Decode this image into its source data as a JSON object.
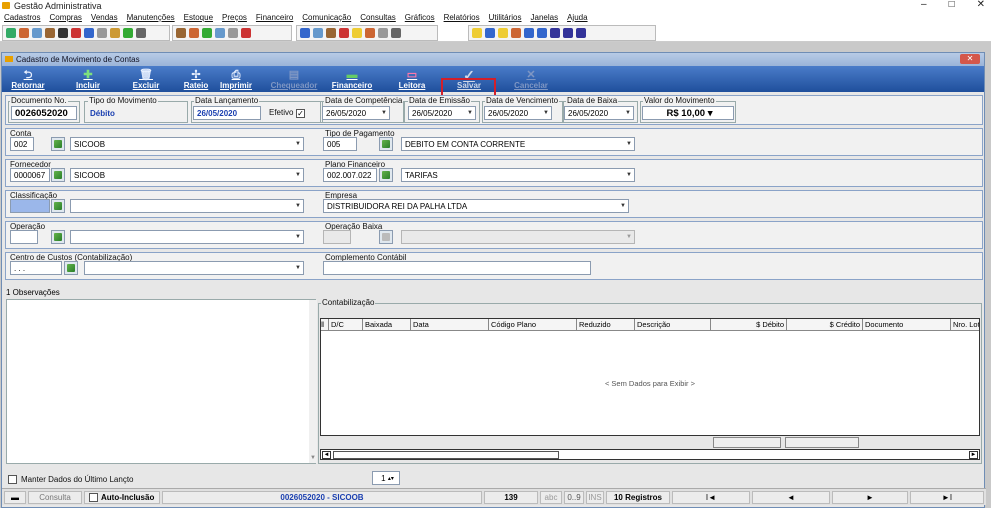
{
  "app_title": "Gestão Administrativa",
  "window_controls": {
    "min": "–",
    "max": "□",
    "close": "✕"
  },
  "menu": [
    "Cadastros",
    "Compras",
    "Vendas",
    "Manutenções",
    "Estoque",
    "Preços",
    "Financeiro",
    "Comunicação",
    "Consultas",
    "Gráficos",
    "Relatórios",
    "Utilitários",
    "Janelas",
    "Ajuda"
  ],
  "window_title": "Cadastro de Movimento de Contas",
  "toolbar": {
    "retornar": "Retornar",
    "incluir": "Incluir",
    "excluir": "Excluir",
    "rateio": "Rateio",
    "imprimir": "Imprimir",
    "chequeador": "Chequeador",
    "financeiro": "Financeiro",
    "leitora": "Leitora",
    "salvar": "Salvar",
    "cancelar": "Cancelar"
  },
  "form": {
    "documento": {
      "label": "Documento No.",
      "value": "0026052020"
    },
    "tipo": {
      "label": "Tipo do Movimento",
      "value": "Débito"
    },
    "lancamento": {
      "label": "Data Lançamento",
      "value": "26/05/2020"
    },
    "efetivo": {
      "label": "Efetivo",
      "checked": "✓"
    },
    "competencia": {
      "label": "Data de Competência",
      "value": "26/05/2020"
    },
    "emissao": {
      "label": "Data de Emissão",
      "value": "26/05/2020"
    },
    "vencimento": {
      "label": "Data de Vencimento",
      "value": "26/05/2020"
    },
    "baixa": {
      "label": "Data de Baixa",
      "value": "26/05/2020"
    },
    "valor": {
      "label": "Valor do Movimento",
      "value": "R$ 10,00"
    },
    "conta": {
      "label": "Conta",
      "code": "002",
      "name": "SICOOB"
    },
    "tipo_pagamento": {
      "label": "Tipo de Pagamento",
      "code": "005",
      "name": "DEBITO EM CONTA CORRENTE"
    },
    "fornecedor": {
      "label": "Fornecedor",
      "code": "0000067",
      "name": "SICOOB"
    },
    "plano": {
      "label": "Plano Financeiro",
      "code": "002.007.022",
      "name": "TARIFAS"
    },
    "classificacao": {
      "label": "Classificação"
    },
    "empresa": {
      "label": "Empresa",
      "name": "DISTRIBUIDORA REI DA PALHA LTDA"
    },
    "operacao": {
      "label": "Operação"
    },
    "operacao_baixa": {
      "label": "Operação Baixa"
    },
    "centro_custos": {
      "label": "Centro de Custos (Contabilização)",
      "code": ". . ."
    },
    "complemento": {
      "label": "Complemento Contábil"
    }
  },
  "obs_tab": "1 Observações",
  "contabilizacao": {
    "label": "Contabilização",
    "columns": [
      "D/C",
      "Baixada",
      "Data",
      "Código Plano",
      "Reduzido",
      "Descrição",
      "$ Débito",
      "$ Crédito",
      "Documento",
      "Nro. Lote"
    ],
    "empty_text": "< Sem Dados para Exibir >"
  },
  "manter": "Manter Dados do Último Lançto",
  "spinner": "1",
  "status": {
    "consulta": "Consulta",
    "auto": "Auto-Inclusão",
    "record": "0026052020 - SICOOB",
    "count": "139",
    "abc": "abc",
    "range": "0..9",
    "ins": "INS",
    "registros": "10 Registros",
    "first": "I◄",
    "prev": "◄",
    "next": "►",
    "last": "►I"
  }
}
